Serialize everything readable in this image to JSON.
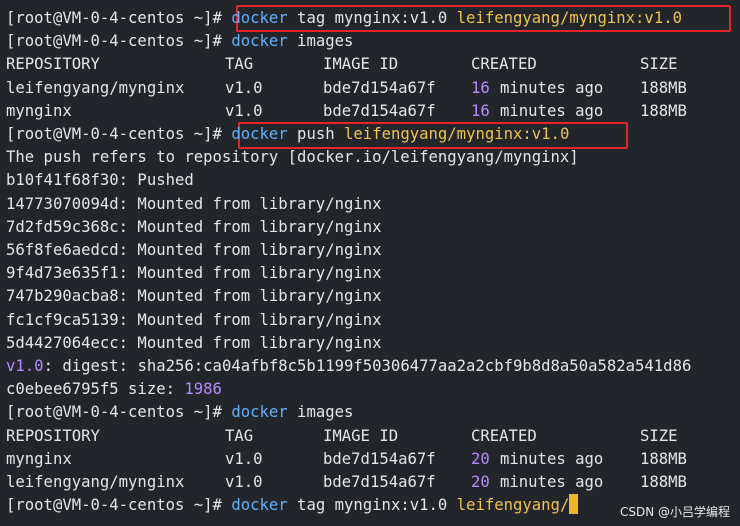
{
  "terminal": {
    "prompt": "[root@VM-0-4-centos ~]#",
    "lines": [
      {
        "type": "cmd",
        "text1": "docker",
        "text2": " tag mynginx:v1.0 ",
        "text3": "leifengyang/mynginx:v1.0"
      },
      {
        "type": "cmd",
        "text1": "docker",
        "text2": " images"
      },
      {
        "type": "table",
        "cols": [
          "REPOSITORY",
          "TAG",
          "IMAGE ID",
          "CREATED",
          "SIZE"
        ]
      },
      {
        "type": "row",
        "cols": [
          "leifengyang/mynginx",
          "v1.0",
          "bde7d154a67f",
          "16",
          "minutes ago",
          "188MB"
        ]
      },
      {
        "type": "row",
        "cols": [
          "mynginx",
          "v1.0",
          "bde7d154a67f",
          "16",
          "minutes ago",
          "188MB"
        ]
      },
      {
        "type": "cmd",
        "text1": "docker",
        "text2": " push ",
        "text3": "leifengyang/mynginx:v1.0"
      },
      {
        "type": "text",
        "text": "The push refers to repository [docker.io/leifengyang/mynginx]"
      },
      {
        "type": "text",
        "text": "b10f41f68f30: Pushed"
      },
      {
        "type": "text",
        "text": "14773070094d: Mounted from library/nginx"
      },
      {
        "type": "text",
        "text": "7d2fd59c368c: Mounted from library/nginx"
      },
      {
        "type": "text",
        "text": "56f8fe6aedcd: Mounted from library/nginx"
      },
      {
        "type": "text",
        "text": "9f4d73e635f1: Mounted from library/nginx"
      },
      {
        "type": "text",
        "text": "747b290acba8: Mounted from library/nginx"
      },
      {
        "type": "text",
        "text": "fc1cf9ca5139: Mounted from library/nginx"
      },
      {
        "type": "text",
        "text": "5d4427064ecc: Mounted from library/nginx"
      },
      {
        "type": "digest",
        "a": "v1.0",
        "b": ": digest: sha256:ca04afbf8c5b1199f50306477aa2a2cbf9b8d8a50a582a541d86"
      },
      {
        "type": "size",
        "a": "c0ebee6795f5 size: ",
        "b": "1986"
      },
      {
        "type": "cmd",
        "text1": "docker",
        "text2": " images"
      },
      {
        "type": "table",
        "cols": [
          "REPOSITORY",
          "TAG",
          "IMAGE ID",
          "CREATED",
          "SIZE"
        ]
      },
      {
        "type": "row",
        "cols": [
          "mynginx",
          "v1.0",
          "bde7d154a67f",
          "20",
          "minutes ago",
          "188MB"
        ]
      },
      {
        "type": "row",
        "cols": [
          "leifengyang/mynginx",
          "v1.0",
          "bde7d154a67f",
          "20",
          "minutes ago",
          "188MB"
        ]
      },
      {
        "type": "cmdPartial",
        "text1": "docker",
        "text2": " tag mynginx:v1.0 ",
        "text3": "leifengyang/"
      }
    ],
    "watermark": "CSDN @小吕学编程"
  }
}
